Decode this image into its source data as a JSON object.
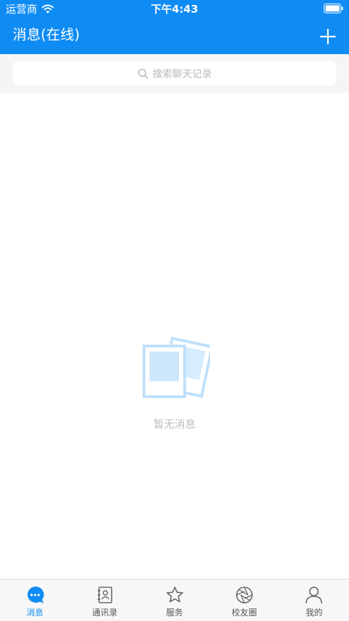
{
  "status": {
    "carrier": "运营商",
    "time": "下午4:43"
  },
  "nav": {
    "title": "消息(在线)"
  },
  "search": {
    "placeholder": "搜索聊天记录"
  },
  "empty": {
    "text": "暂无消息"
  },
  "tabs": [
    {
      "label": "消息",
      "icon": "chat-icon",
      "active": true
    },
    {
      "label": "通讯录",
      "icon": "contacts-icon",
      "active": false
    },
    {
      "label": "服务",
      "icon": "star-icon",
      "active": false
    },
    {
      "label": "校友圈",
      "icon": "aperture-icon",
      "active": false
    },
    {
      "label": "我的",
      "icon": "person-icon",
      "active": false
    }
  ],
  "colors": {
    "brand": "#0f8cf4",
    "placeholder": "#b8b8b8",
    "tabbar_bg": "#f7f7f7"
  }
}
